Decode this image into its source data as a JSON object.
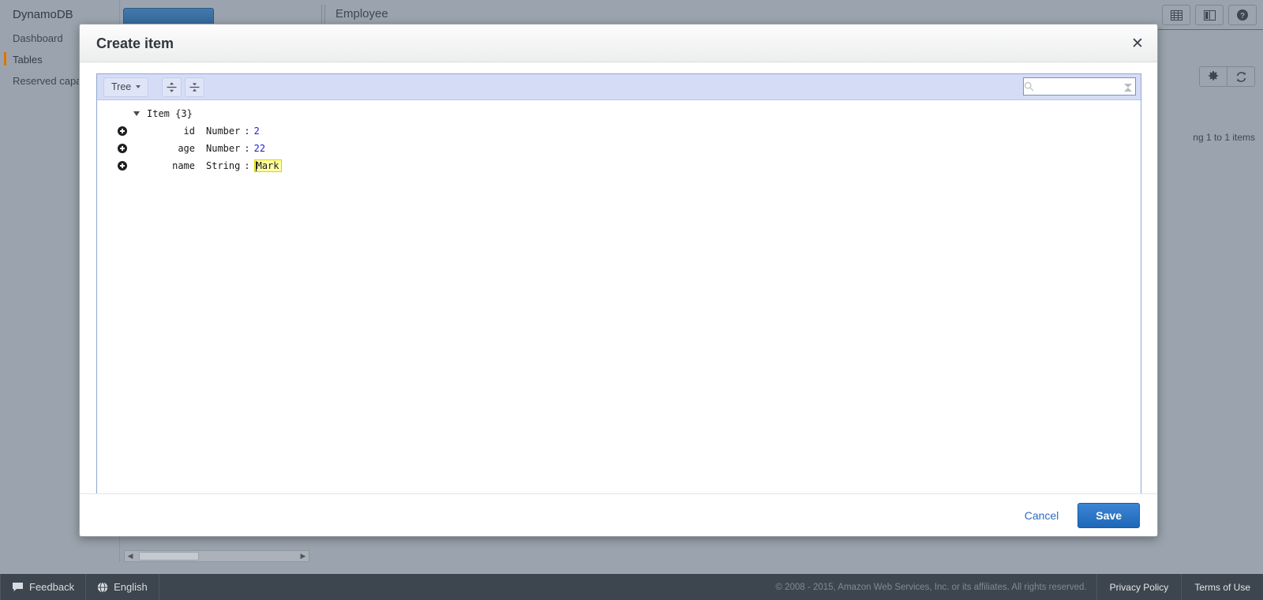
{
  "sidebar": {
    "brand": "DynamoDB",
    "items": [
      {
        "label": "Dashboard",
        "active": false
      },
      {
        "label": "Tables",
        "active": true
      },
      {
        "label": "Reserved capacity",
        "active": false
      }
    ]
  },
  "topbar": {
    "table_name": "Employee",
    "create_button_label": "",
    "icons": [
      {
        "name": "table-view-icon",
        "glyph": "grid"
      },
      {
        "name": "split-view-icon",
        "glyph": "split"
      },
      {
        "name": "help-icon",
        "glyph": "?"
      }
    ]
  },
  "table_controls": {
    "settings_icon": "gear-icon",
    "refresh_icon": "refresh-icon",
    "items_count": "ng 1 to 1 items"
  },
  "modal": {
    "title": "Create item",
    "close_label": "✕",
    "editor": {
      "mode_label": "Tree",
      "expand_all_title": "Expand all",
      "collapse_all_title": "Collapse all",
      "search_placeholder": "",
      "search_value": ""
    },
    "tree": {
      "root_label": "Item {3}",
      "rows": [
        {
          "key": "id",
          "type": "Number",
          "value": "2",
          "value_kind": "number"
        },
        {
          "key": "age",
          "type": "Number",
          "value": "22",
          "value_kind": "number"
        },
        {
          "key": "name",
          "type": "String",
          "value": "Mark",
          "value_kind": "string-selected"
        }
      ]
    },
    "footer": {
      "cancel_label": "Cancel",
      "save_label": "Save"
    }
  },
  "footer": {
    "feedback_label": "Feedback",
    "language_label": "English",
    "copyright": "© 2008 - 2015, Amazon Web Services, Inc. or its affiliates. All rights reserved.",
    "privacy_label": "Privacy Policy",
    "terms_label": "Terms of Use"
  },
  "colors": {
    "accent_orange": "#e07000",
    "primary_blue": "#1f67b8",
    "link_blue": "#2f6dbd",
    "highlight_yellow": "#ffffa0",
    "console_gray": "#9aa3ad",
    "footer_dark": "#3a424b"
  }
}
